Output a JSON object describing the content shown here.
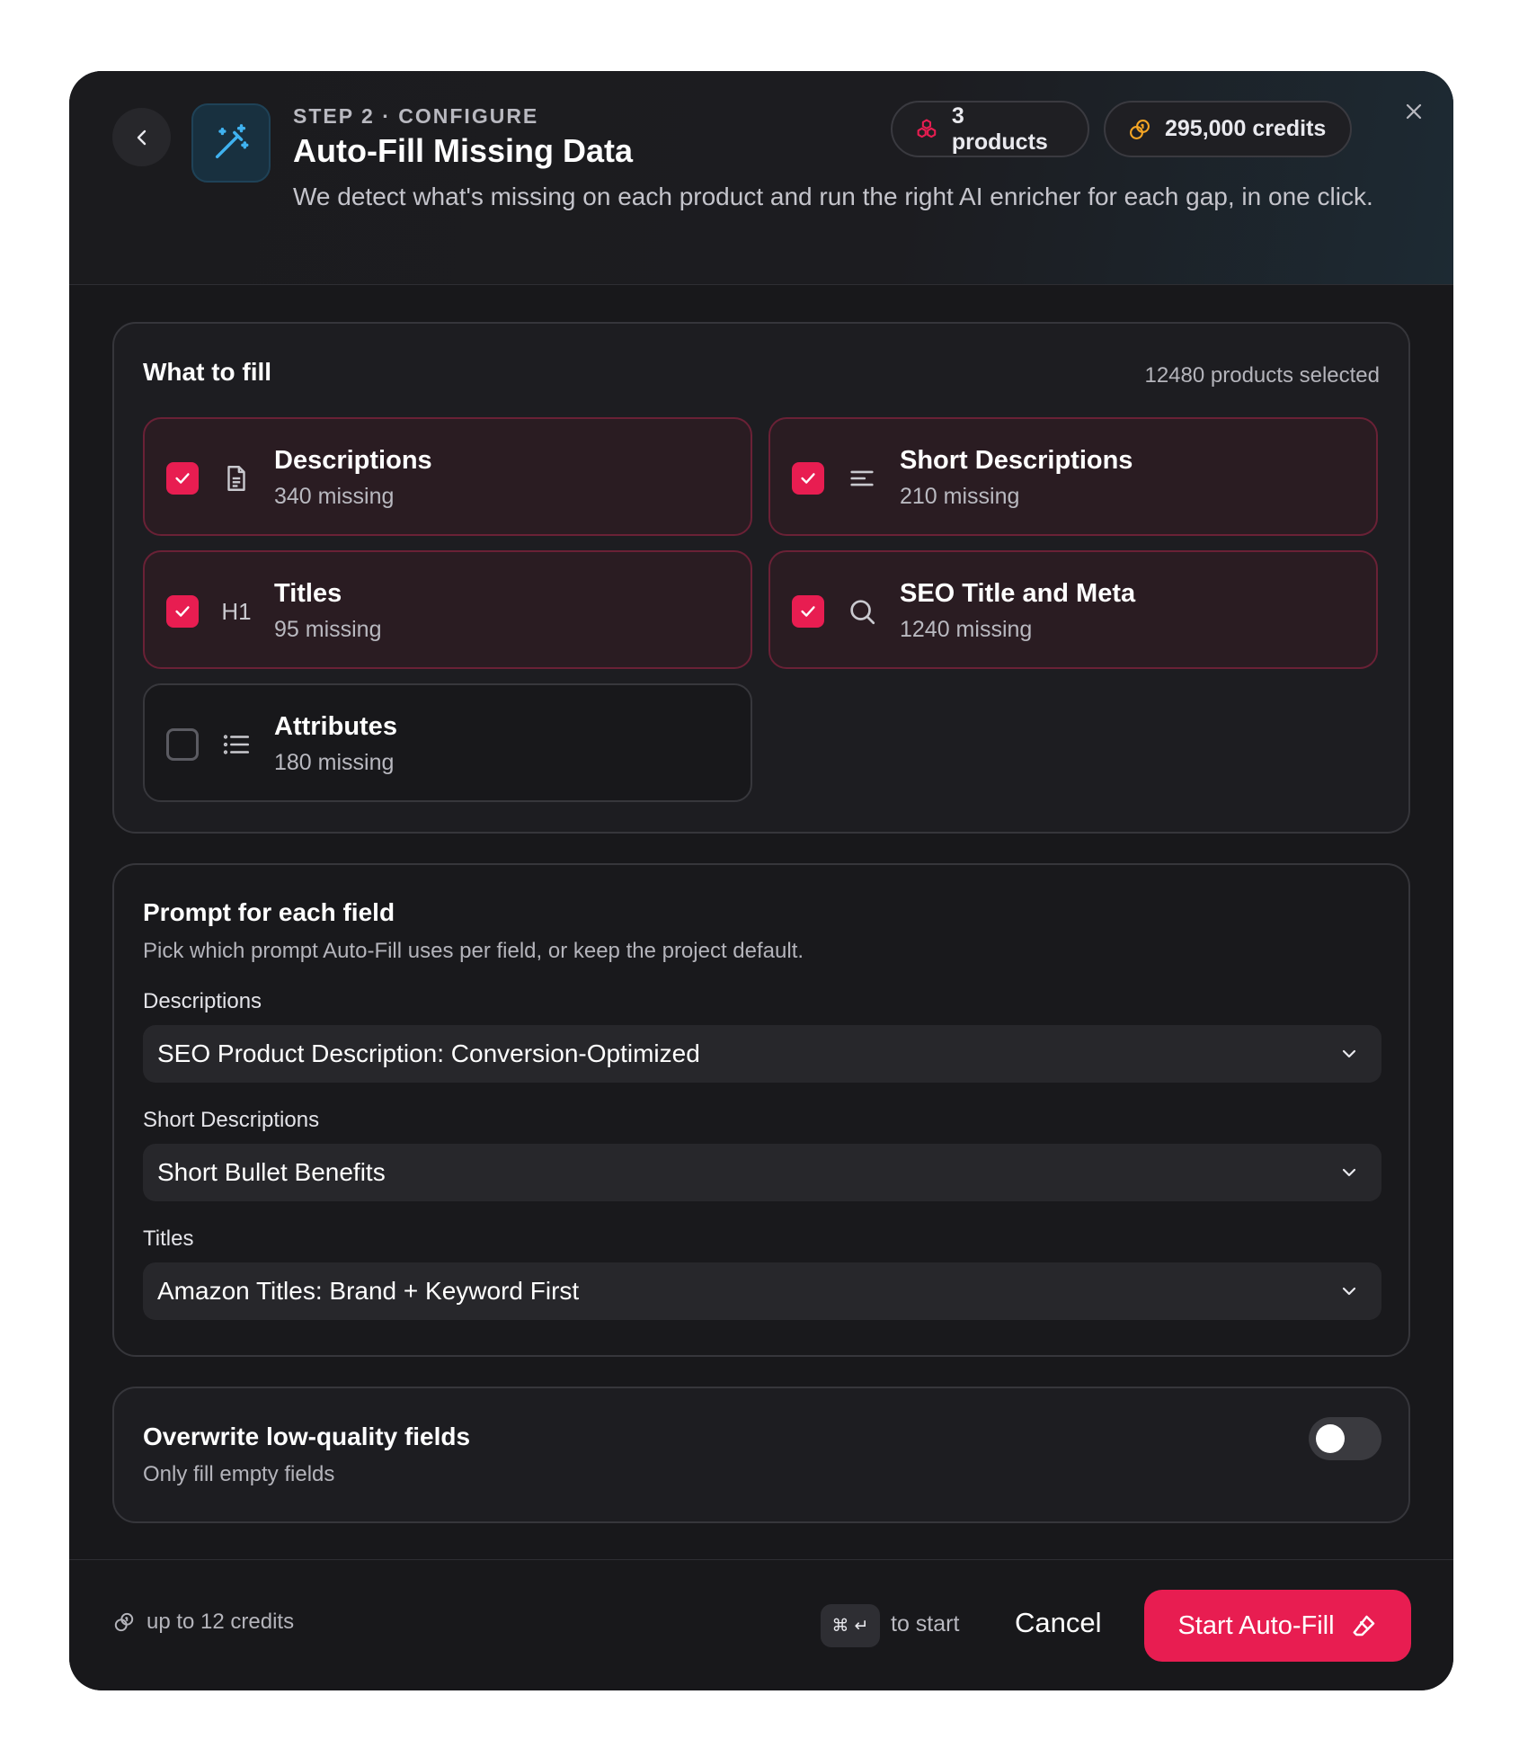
{
  "header": {
    "step": "STEP 2 · CONFIGURE",
    "title": "Auto-Fill Missing Data",
    "subtitle": "We detect what's missing on each product and run the right AI enricher for each gap, in one click.",
    "products_pill": "3 products",
    "credits_pill": "295,000 credits"
  },
  "what_to_fill": {
    "title": "What to fill",
    "selected_count": "12480 products selected",
    "fields": [
      {
        "name": "Descriptions",
        "missing": "340 missing",
        "checked": true,
        "icon": "document-icon"
      },
      {
        "name": "Short Descriptions",
        "missing": "210 missing",
        "checked": true,
        "icon": "align-left-icon"
      },
      {
        "name": "Titles",
        "missing": "95 missing",
        "checked": true,
        "icon": "h1-icon",
        "icon_text": "H1"
      },
      {
        "name": "SEO Title and Meta",
        "missing": "1240 missing",
        "checked": true,
        "icon": "search-icon"
      },
      {
        "name": "Attributes",
        "missing": "180 missing",
        "checked": false,
        "icon": "list-icon"
      }
    ]
  },
  "prompts": {
    "title": "Prompt for each field",
    "subtitle": "Pick which prompt Auto-Fill uses per field, or keep the project default.",
    "fields": [
      {
        "label": "Descriptions",
        "value": "SEO Product Description: Conversion-Optimized"
      },
      {
        "label": "Short Descriptions",
        "value": "Short Bullet Benefits"
      },
      {
        "label": "Titles",
        "value": "Amazon Titles: Brand + Keyword First"
      }
    ]
  },
  "overwrite": {
    "title": "Overwrite low-quality fields",
    "subtitle": "Only fill empty fields",
    "enabled": false
  },
  "footer": {
    "cost": "up to 12 credits",
    "shortcut": "⌘ ↵",
    "shortcut_hint": "to start",
    "cancel_label": "Cancel",
    "start_label": "Start Auto-Fill"
  },
  "colors": {
    "accent": "#e81d51",
    "credits_icon": "#f5a524",
    "wand_icon": "#3fb2f0",
    "modal_bg": "#18181b"
  }
}
